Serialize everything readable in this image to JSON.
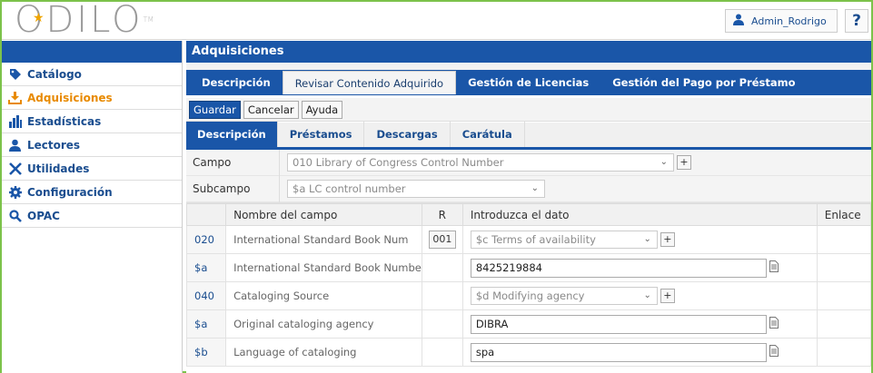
{
  "header": {
    "logo": "ODILO",
    "logo_tm": "TM",
    "user_name": "Admin_Rodrigo",
    "help_label": "?"
  },
  "sidebar": {
    "items": [
      {
        "label": "Catálogo",
        "icon": "tag-icon",
        "active": false
      },
      {
        "label": "Adquisiciones",
        "icon": "download-tray-icon",
        "active": true
      },
      {
        "label": "Estadísticas",
        "icon": "bar-chart-icon",
        "active": false
      },
      {
        "label": "Lectores",
        "icon": "person-icon",
        "active": false
      },
      {
        "label": "Utilidades",
        "icon": "tools-icon",
        "active": false
      },
      {
        "label": "Configuración",
        "icon": "gear-icon",
        "active": false
      },
      {
        "label": "OPAC",
        "icon": "search-icon",
        "active": false
      }
    ]
  },
  "main": {
    "title": "Adquisiciones",
    "tabs": [
      {
        "label": "Descripción",
        "active": false
      },
      {
        "label": "Revisar Contenido Adquirido",
        "active": true
      },
      {
        "label": "Gestión de Licencias",
        "active": false
      },
      {
        "label": "Gestión del Pago por Préstamo",
        "active": false
      }
    ],
    "toolbar": {
      "save": "Guardar",
      "cancel": "Cancelar",
      "help": "Ayuda"
    },
    "subtabs": [
      {
        "label": "Descripción",
        "active": true
      },
      {
        "label": "Préstamos",
        "active": false
      },
      {
        "label": "Descargas",
        "active": false
      },
      {
        "label": "Carátula",
        "active": false
      }
    ],
    "campo_label": "Campo",
    "campo_value": "010 Library of Congress Control Number",
    "subcampo_label": "Subcampo",
    "subcampo_value": "$a LC control number",
    "columns": {
      "name": "Nombre del campo",
      "r": "R",
      "data": "Introduzca el dato",
      "link": "Enlace"
    },
    "rows": [
      {
        "code": "020",
        "name": "International Standard Book Num",
        "r": "001",
        "type": "select",
        "value": "$c Terms of availability"
      },
      {
        "code": "$a",
        "name": "International Standard Book Numbe",
        "r": "",
        "type": "input",
        "value": "8425219884"
      },
      {
        "code": "040",
        "name": "Cataloging Source",
        "r": "",
        "type": "select",
        "value": "$d Modifying agency"
      },
      {
        "code": "$a",
        "name": "Original cataloging agency",
        "r": "",
        "type": "input",
        "value": "DIBRA"
      },
      {
        "code": "$b",
        "name": "Language of cataloging",
        "r": "",
        "type": "input",
        "value": "spa"
      }
    ]
  },
  "colors": {
    "primary": "#1a56a8",
    "active_menu": "#e88a00",
    "frame": "#7cc24a"
  }
}
